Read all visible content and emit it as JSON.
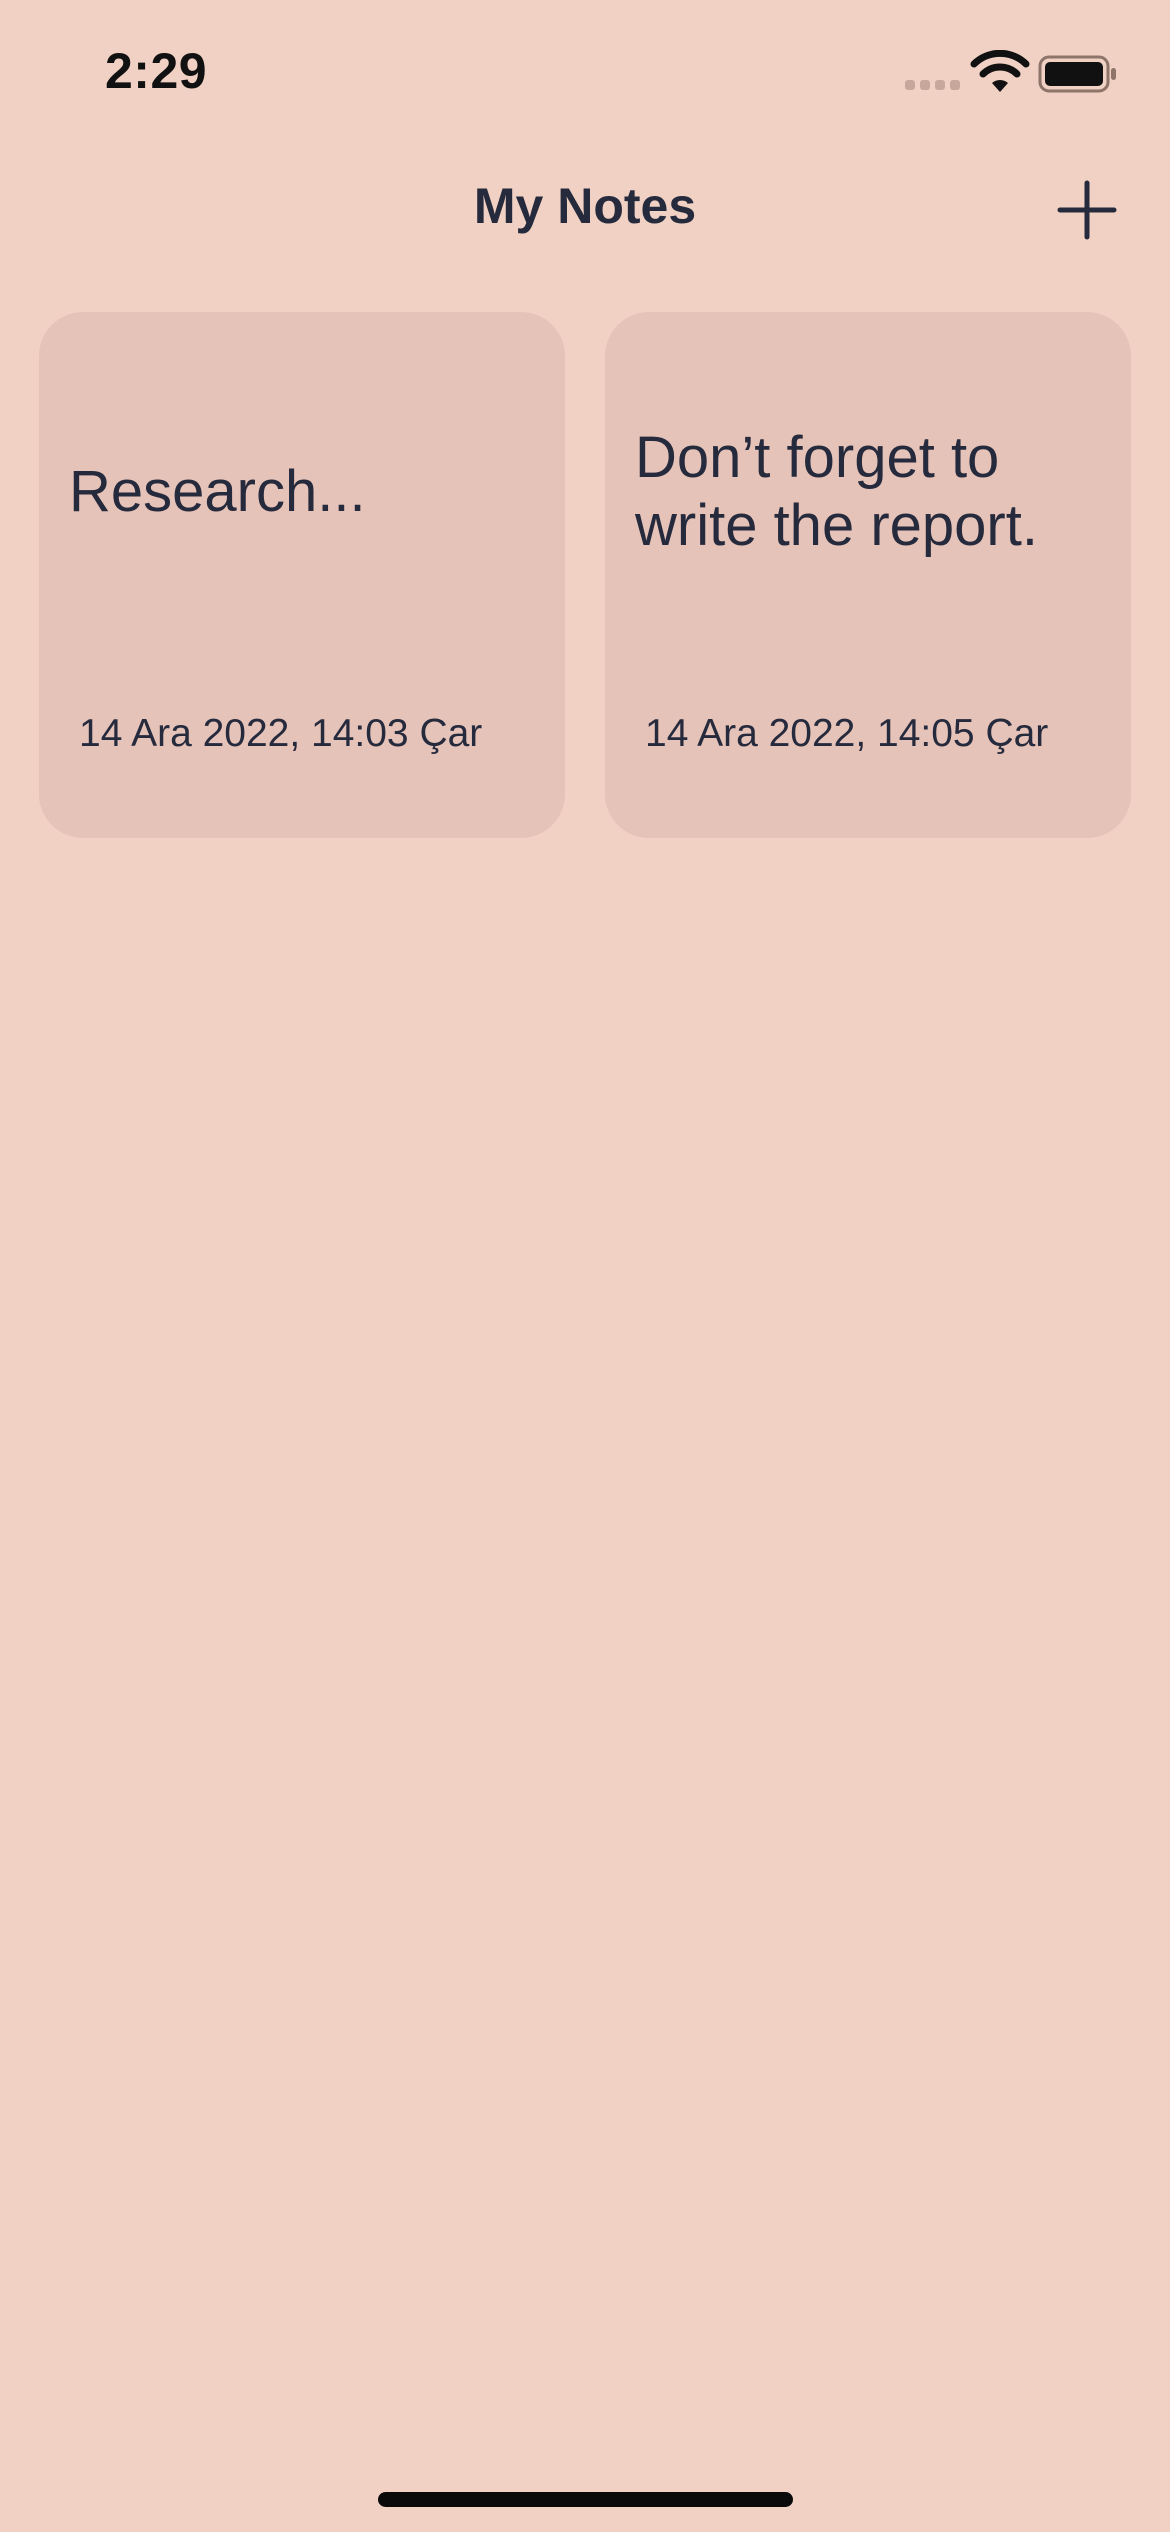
{
  "status_bar": {
    "time": "2:29",
    "icons": [
      "cellular-signal-icon",
      "wifi-icon",
      "battery-icon"
    ]
  },
  "nav": {
    "title": "My Notes",
    "add_icon": "plus-icon"
  },
  "notes": [
    {
      "text": "Research...",
      "date": "14 Ara 2022, 14:03 Çar"
    },
    {
      "text": "Don’t forget to write the report.",
      "date": "14 Ara 2022, 14:05 Çar"
    }
  ],
  "colors": {
    "background": "#f0d1c3",
    "card": "#e6c3b9",
    "text": "#262a3d"
  }
}
